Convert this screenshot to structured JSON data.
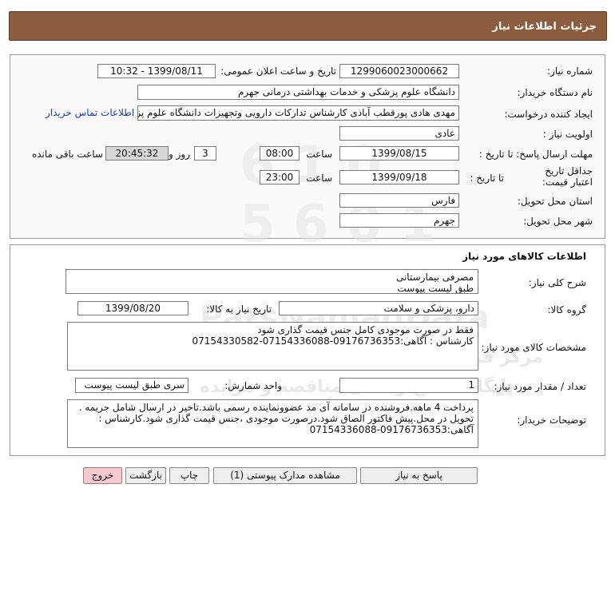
{
  "header": {
    "title": "جزئیات اطلاعات نیاز"
  },
  "need_info": {
    "need_number_label": "شماره نیاز:",
    "need_number": "1299060023000662",
    "announce_datetime_label": "تاریخ و ساعت اعلان عمومی:",
    "announce_datetime": "1399/08/11 - 10:32",
    "buyer_org_label": "نام دستگاه خریدار:",
    "buyer_org": "دانشگاه علوم پزشکی و خدمات بهداشتی درمانی جهرم",
    "requester_label": "ایجاد کننده درخواست:",
    "requester": "مهدی هادی پورقطب آبادی کارشناس تدارکات دارویی وتجهیزات دانشگاه علوم پزشکی",
    "contact_link": "اطلاعات تماس خریدار",
    "priority_label": "اولویت نیاز :",
    "priority": "عادی",
    "reply_deadline_label": "مهلت ارسال پاسخ: تا تاریخ :",
    "reply_date": "1399/08/15",
    "time_label": "ساعت",
    "reply_time": "08:00",
    "days": "3",
    "days_label": "روز و",
    "remaining_time": "20:45:32",
    "remaining_label": "ساعت باقی مانده",
    "price_validity_label": "جداقل تاریخ اعتبار قیمت:",
    "price_validity_to_label": "تا تاریخ :",
    "price_validity_date": "1399/09/18",
    "price_validity_time": "23:00",
    "province_label": "استان محل تحویل:",
    "province": "فارس",
    "city_label": "شهر محل تحویل:",
    "city": "جهرم"
  },
  "goods_section": {
    "title": "اطلاعات کالاهای مورد نیاز",
    "general_desc_label": "شرح کلی نیاز:",
    "general_desc_line1": "مصرفی بیمارستانی",
    "general_desc_line2": "طبق لیست پیوست",
    "goods_group_label": "گروه کالا:",
    "goods_group": "دارو، پزشکی و سلامت",
    "need_date_label": "تاریخ نیاز به کالا:",
    "need_date": "1399/08/20",
    "specs_label": "مشخصات کالای مورد نیاز:",
    "specs_line1": "فقط در صورت موجودی کامل جنس قیمت گذاری شود",
    "specs_line2": "کارشناس : آگاهی:09176736353-07154336088-07154330582",
    "quantity_label": "تعداد / مقدار مورد نیاز:",
    "quantity": "1",
    "unit_label": "واحد شمارش:",
    "unit": "سری طبق لیست پیوست",
    "buyer_notes_label": "توضیحات خریدار:",
    "buyer_notes_line1": "پرداخت 4 ماهه.فروشنده در سامانه آی مد عضوونماینده رسمی باشد.تاخیر در ارسال شامل جریمه .",
    "buyer_notes_line2": "تحویل در محل.پیش فاکتور الصاق شود.درصورت موجودی ،جنس قیمت گذاری شود.کارشناس :",
    "buyer_notes_line3": "آگاهی:09176736353-07154336088"
  },
  "actions": {
    "reply": "پاسخ به نیاز",
    "view_attachments": "مشاهده مدارک پیوستی (1)",
    "print": "چاپ",
    "back": "بازگشت",
    "exit": "خروج"
  },
  "watermark": {
    "logo_text": "ParsNamadData",
    "line1": "مرکز فراوری اطلاعات پارس نماد داده",
    "line2": "پایگاه اطلاع رسانی مناقصه و مزایده"
  }
}
